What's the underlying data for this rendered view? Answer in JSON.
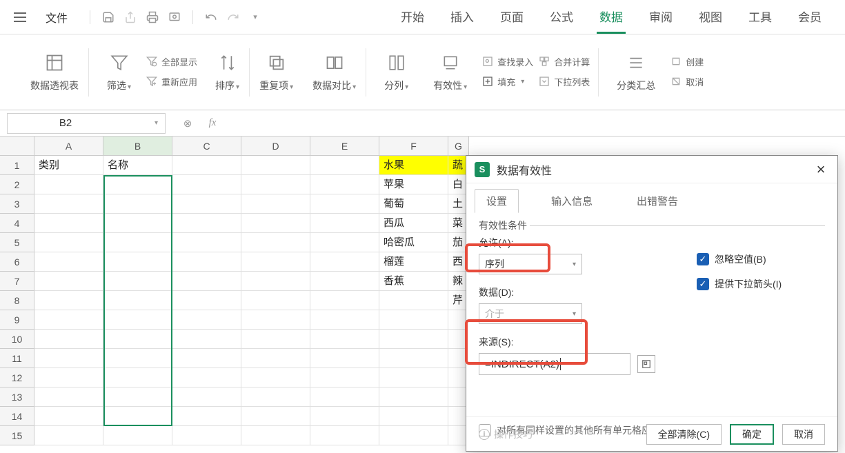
{
  "topbar": {
    "file": "文件",
    "tabs": [
      "开始",
      "插入",
      "页面",
      "公式",
      "数据",
      "审阅",
      "视图",
      "工具",
      "会员"
    ],
    "active_tab_index": 4
  },
  "ribbon": {
    "pivot": "数据透视表",
    "filter": "筛选",
    "show_all": "全部显示",
    "reapply": "重新应用",
    "sort": "排序",
    "dup": "重复项",
    "compare": "数据对比",
    "split_col": "分列",
    "validity": "有效性",
    "fill": "填充",
    "find_entry": "查找录入",
    "consolidate": "合并计算",
    "dropdown_list": "下拉列表",
    "group_sum": "分类汇总",
    "create": "创建",
    "cancel": "取消"
  },
  "formula_bar": {
    "name_box": "B2",
    "fx_value": ""
  },
  "columns": [
    "A",
    "B",
    "C",
    "D",
    "E",
    "F",
    "G"
  ],
  "rows_count": 15,
  "cells": {
    "A1": "类别",
    "B1": "名称",
    "F1": "水果",
    "G1": "蔬",
    "F2": "苹果",
    "G2": "白",
    "F3": "葡萄",
    "G3": "土",
    "F4": "西瓜",
    "G4": "菜",
    "F5": "哈密瓜",
    "G5": "茄",
    "F6": "榴莲",
    "G6": "西",
    "F7": "香蕉",
    "G7": "辣",
    "G8": "芹"
  },
  "dialog": {
    "title": "数据有效性",
    "tabs": [
      "设置",
      "输入信息",
      "出错警告"
    ],
    "active_tab_index": 0,
    "fieldset": "有效性条件",
    "allow_label": "允许(A):",
    "allow_value": "序列",
    "data_label": "数据(D):",
    "data_value": "介于",
    "source_label": "来源(S):",
    "source_value": "=INDIRECT(A2)",
    "ignore_blank": "忽略空值(B)",
    "provide_dropdown": "提供下拉箭头(I)",
    "apply_all": "对所有同样设置的其他所有单元格应用这些更改(P)",
    "clear_all": "全部清除(C)",
    "ok": "确定",
    "cancel": "取消",
    "footer_hint": "操作技巧"
  }
}
